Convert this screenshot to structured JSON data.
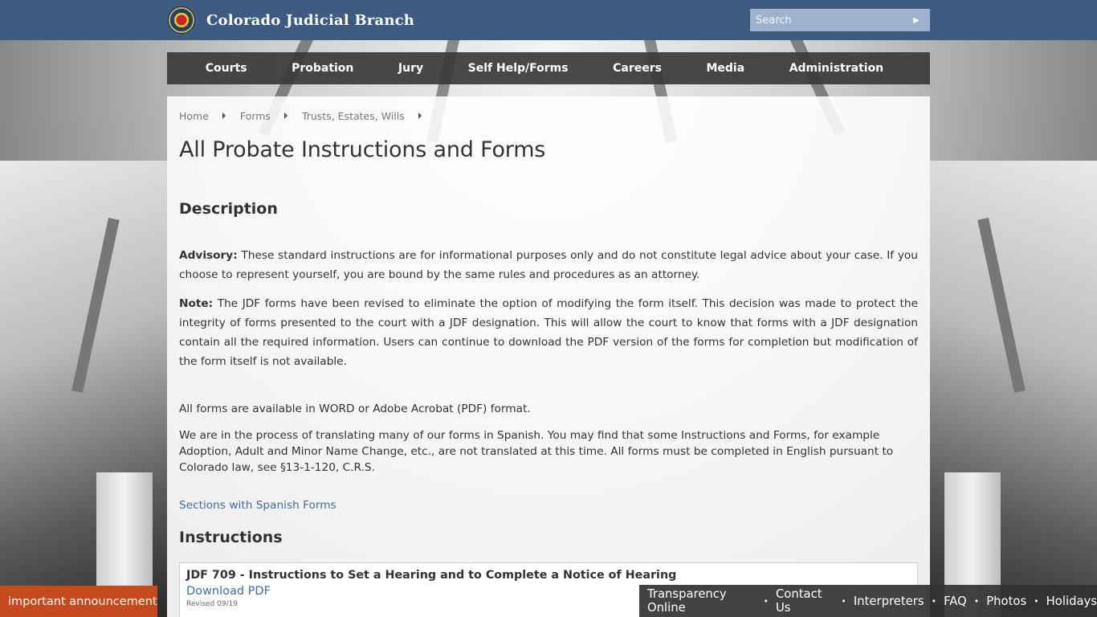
{
  "header": {
    "brand_name": "Colorado Judicial Branch",
    "search_placeholder": "Search",
    "colors": {
      "header_bg": "#3d5b80",
      "search_bg": "#9db2cc"
    }
  },
  "nav": {
    "items": [
      "Courts",
      "Probation",
      "Jury",
      "Self Help/Forms",
      "Careers",
      "Media",
      "Administration"
    ]
  },
  "breadcrumb": [
    "Home",
    "Forms",
    "Trusts, Estates, Wills"
  ],
  "page": {
    "title": "All Probate Instructions and Forms",
    "description_heading": "Description",
    "advisory_label": "Advisory:",
    "advisory_text": " These standard instructions are for informational purposes only and do not constitute legal advice about your case. If you choose to represent yourself, you are bound by the same rules and procedures as an attorney.",
    "note_label": "Note:",
    "note_text": " The JDF forms have been revised to eliminate the option of modifying the form itself. This decision was made to protect the integrity of forms presented to the court with a JDF designation. This will allow the court to know that forms with a JDF designation contain all the required information. Users can continue to download the PDF version of the forms for completion but modification of the form itself is not available.",
    "formats_text": "All forms are available in WORD or Adobe Acrobat (PDF) format.",
    "spanish_text": "We are in the process of translating many of our forms in Spanish. You may find that some Instructions and Forms, for example Adoption, Adult and Minor Name Change, etc., are not translated at this time. All forms must be completed in English pursuant to Colorado law, see §13-1-120, C.R.S.",
    "spanish_link": "Sections with Spanish Forms",
    "instructions_heading": "Instructions"
  },
  "forms": [
    {
      "title": "JDF 709 - Instructions to Set a Hearing and to Complete a Notice of Hearing",
      "link": "Download PDF",
      "revised": "Revised 09/19"
    }
  ],
  "announcement": "important announcement",
  "footer": {
    "links": [
      "Transparency Online",
      "Contact Us",
      "Interpreters",
      "FAQ",
      "Photos",
      "Holidays"
    ],
    "colors": {
      "announce_bg": "#c64a1e",
      "link_color": "#3f6ea5"
    }
  }
}
